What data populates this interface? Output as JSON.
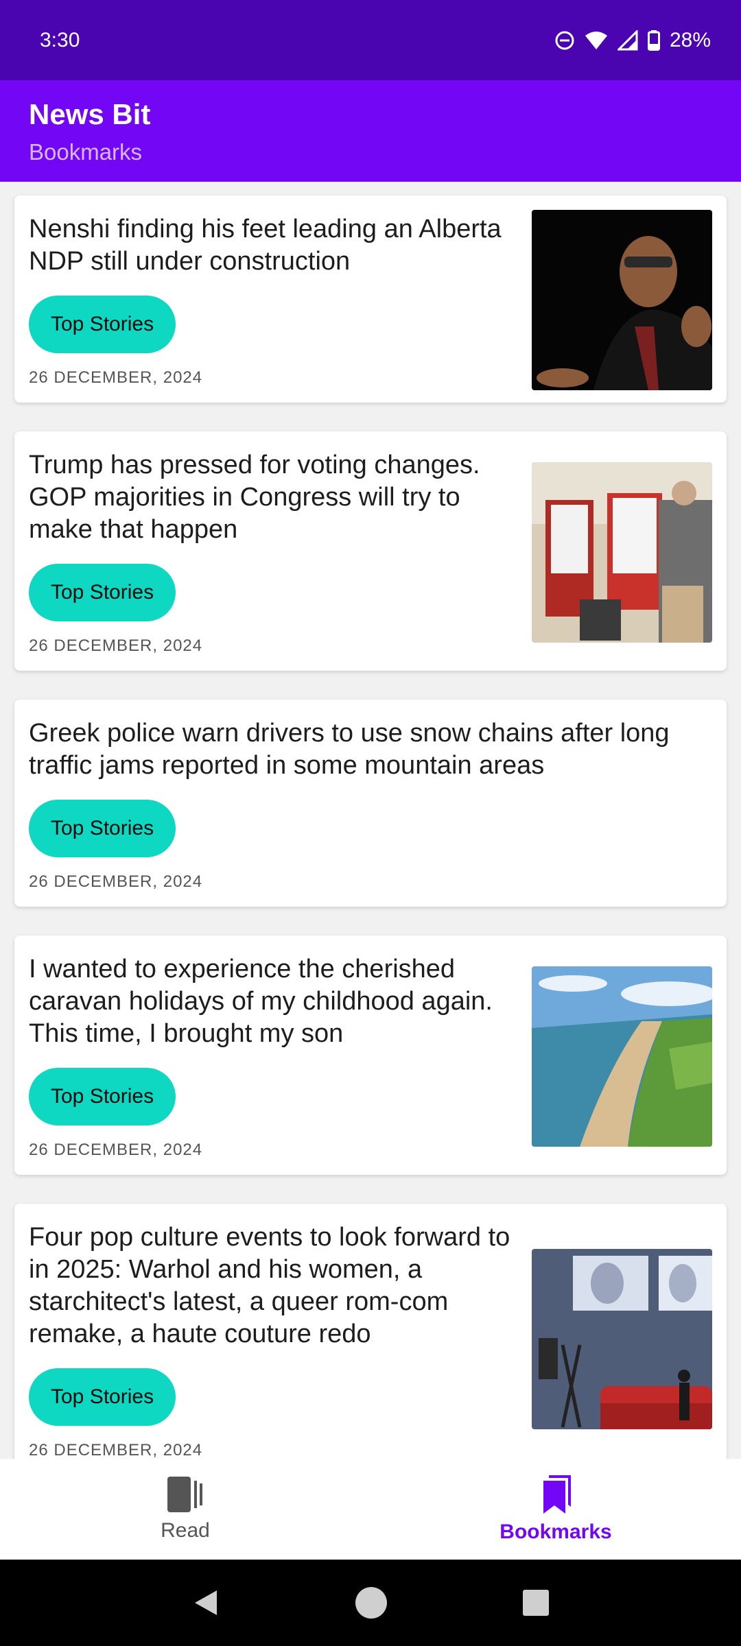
{
  "status_bar": {
    "time": "3:30",
    "battery": "28%",
    "icons": [
      "do-not-disturb-icon",
      "wifi-icon",
      "signal-icon",
      "battery-icon"
    ]
  },
  "app_bar": {
    "title": "News Bit",
    "subtitle": "Bookmarks"
  },
  "articles": [
    {
      "title": "Nenshi finding his feet leading an Alberta NDP still under construction",
      "category": "Top Stories",
      "date": "26 DECEMBER, 2024",
      "has_image": true
    },
    {
      "title": "Trump has pressed for voting changes. GOP majorities in Congress will try to make that happen",
      "category": "Top Stories",
      "date": "26 DECEMBER, 2024",
      "has_image": true
    },
    {
      "title": "Greek police warn drivers to use snow chains after long traffic jams reported in some mountain areas",
      "category": "Top Stories",
      "date": "26 DECEMBER, 2024",
      "has_image": false
    },
    {
      "title": "I wanted to experience the cherished caravan holidays of my childhood again. This time, I brought my son",
      "category": "Top Stories",
      "date": "26 DECEMBER, 2024",
      "has_image": true
    },
    {
      "title": "Four pop culture events to look forward to in 2025: Warhol and his women, a starchitect's latest, a queer rom-com remake, a haute couture redo",
      "category": "Top Stories",
      "date": "26 DECEMBER, 2024",
      "has_image": true
    }
  ],
  "bottom_nav": {
    "items": [
      {
        "label": "Read",
        "icon": "read-icon",
        "active": false
      },
      {
        "label": "Bookmarks",
        "icon": "bookmarks-icon",
        "active": true
      }
    ]
  },
  "colors": {
    "status_bar": "#4a05b0",
    "app_bar": "#7307f5",
    "chip": "#0fd8c2",
    "active_nav": "#7307f5"
  }
}
